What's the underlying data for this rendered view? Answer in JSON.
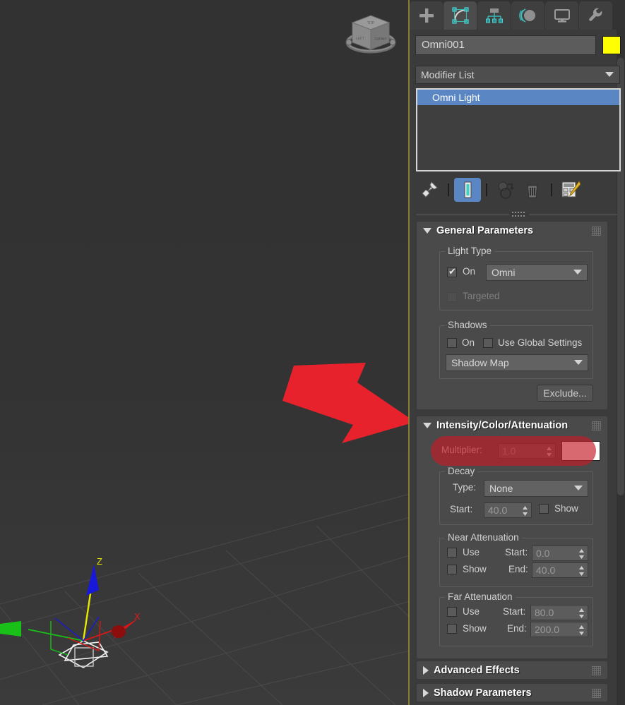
{
  "app": {
    "name": "3ds Max Command Panel"
  },
  "viewport": {
    "viewcube_faces": {
      "top": "TOP",
      "left": "LEFT",
      "front": "FRONT"
    },
    "axis_labels": {
      "z": "Z",
      "x": "X"
    },
    "annotation": {
      "type": "red-arrow",
      "color": "#E8222C",
      "points_at": "multiplier-field"
    },
    "border_color": "#867C33",
    "background_color": "#333333"
  },
  "panel": {
    "tabs": [
      {
        "name": "create",
        "icon": "plus-icon",
        "active": false
      },
      {
        "name": "modify",
        "icon": "modify-icon",
        "active": true
      },
      {
        "name": "hierarchy",
        "icon": "hierarchy-icon",
        "active": false
      },
      {
        "name": "motion",
        "icon": "motion-icon",
        "active": false
      },
      {
        "name": "display",
        "icon": "display-icon",
        "active": false
      },
      {
        "name": "utilities",
        "icon": "wrench-icon",
        "active": false
      }
    ],
    "object_name": "Omni001",
    "wire_color": "#FFFF00",
    "modifier_list_label": "Modifier List",
    "stack": [
      {
        "label": "Omni Light",
        "selected": true
      }
    ],
    "stack_tools": [
      {
        "name": "pin-stack",
        "icon": "pin-icon",
        "selected": false
      },
      {
        "name": "show-end-result",
        "icon": "show-end-result-icon",
        "selected": true
      },
      {
        "name": "make-unique",
        "icon": "make-unique-icon",
        "selected": false
      },
      {
        "name": "remove-modifier",
        "icon": "trash-icon",
        "selected": false
      },
      {
        "name": "configure-modifier-sets",
        "icon": "configure-sets-icon",
        "selected": false
      }
    ]
  },
  "general_parameters": {
    "title": "General Parameters",
    "expanded": true,
    "light_type": {
      "group_label": "Light Type",
      "on_label": "On",
      "on_checked": true,
      "type_value": "Omni",
      "targeted_label": "Targeted",
      "targeted_checked": false,
      "targeted_disabled": true
    },
    "shadows": {
      "group_label": "Shadows",
      "on_label": "On",
      "on_checked": false,
      "use_global_label": "Use Global Settings",
      "use_global_checked": false,
      "shadow_type_value": "Shadow Map"
    },
    "exclude_label": "Exclude..."
  },
  "intensity_color_attenuation": {
    "title": "Intensity/Color/Attenuation",
    "expanded": true,
    "multiplier_label": "Multiplier:",
    "multiplier_value": "1.0",
    "multiplier_color": "#FFFFFF",
    "highlight_color": "#C61C26",
    "decay": {
      "group_label": "Decay",
      "type_label": "Type:",
      "type_value": "None",
      "start_label": "Start:",
      "start_value": "40.0",
      "show_label": "Show",
      "show_checked": false
    },
    "near_attenuation": {
      "group_label": "Near Attenuation",
      "use_label": "Use",
      "use_checked": false,
      "show_label": "Show",
      "show_checked": false,
      "start_label": "Start:",
      "start_value": "0.0",
      "end_label": "End:",
      "end_value": "40.0"
    },
    "far_attenuation": {
      "group_label": "Far Attenuation",
      "use_label": "Use",
      "use_checked": false,
      "show_label": "Show",
      "show_checked": false,
      "start_label": "Start:",
      "start_value": "80.0",
      "end_label": "End:",
      "end_value": "200.0"
    }
  },
  "advanced_effects": {
    "title": "Advanced Effects",
    "expanded": false
  },
  "shadow_parameters": {
    "title": "Shadow Parameters",
    "expanded": false
  }
}
